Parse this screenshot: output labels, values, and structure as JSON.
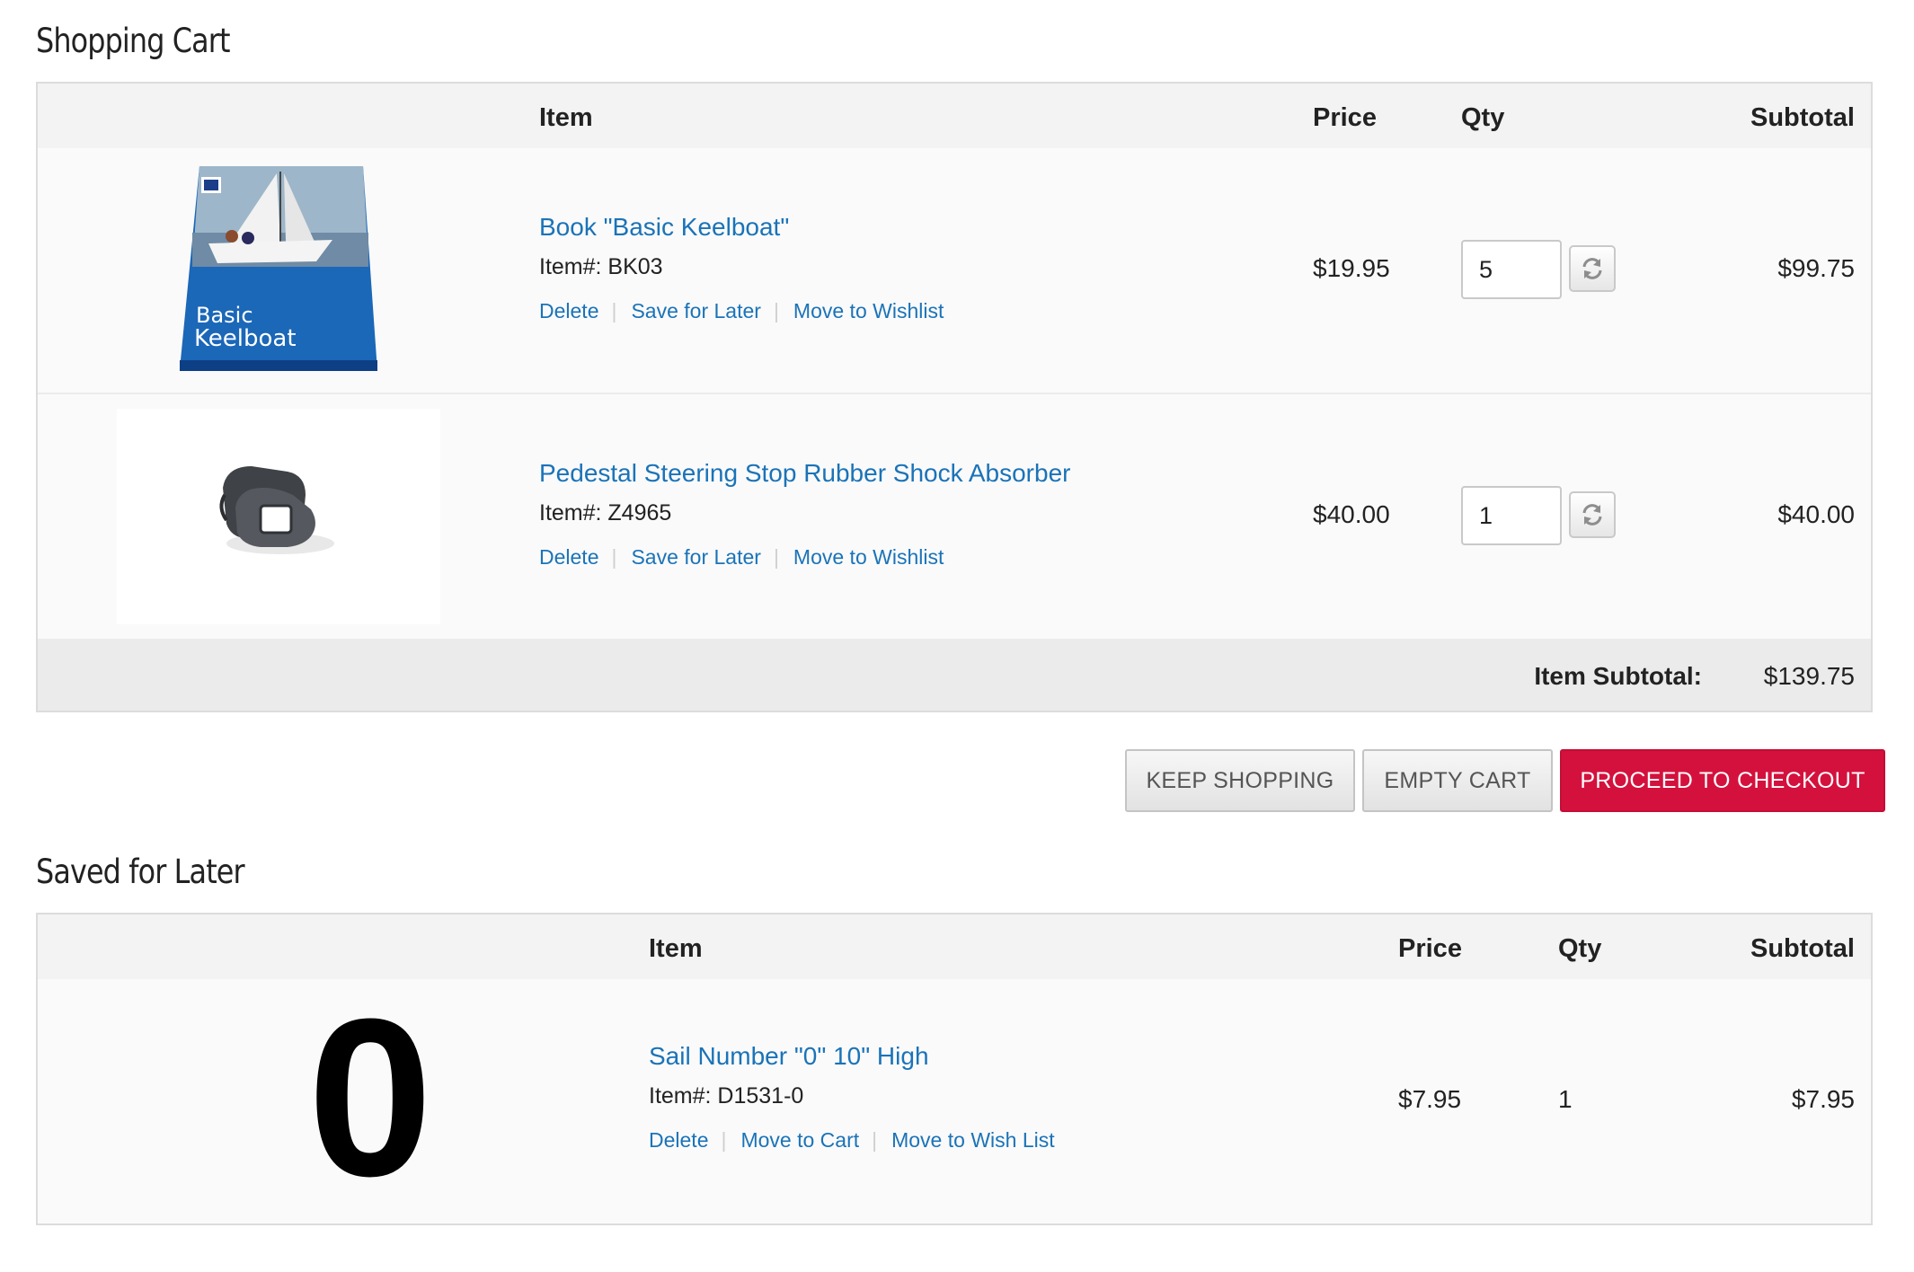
{
  "cart": {
    "title": "Shopping Cart",
    "headers": {
      "item": "Item",
      "price": "Price",
      "qty": "Qty",
      "subtotal": "Subtotal"
    },
    "items": [
      {
        "name": "Book \"Basic Keelboat\"",
        "code": "Item#: BK03",
        "price": "$19.95",
        "qty": "5",
        "subtotal": "$99.75",
        "cover_title_1": "Basic",
        "cover_title_2": "Keelboat",
        "actions": {
          "delete": "Delete",
          "save": "Save for Later",
          "wishlist": "Move to Wishlist"
        }
      },
      {
        "name": "Pedestal Steering Stop Rubber Shock Absorber",
        "code": "Item#: Z4965",
        "price": "$40.00",
        "qty": "1",
        "subtotal": "$40.00",
        "actions": {
          "delete": "Delete",
          "save": "Save for Later",
          "wishlist": "Move to Wishlist"
        }
      }
    ],
    "item_subtotal_label": "Item Subtotal:",
    "item_subtotal_value": "$139.75"
  },
  "buttons": {
    "keep_shopping": "KEEP SHOPPING",
    "empty_cart": "EMPTY CART",
    "checkout": "PROCEED TO CHECKOUT"
  },
  "saved": {
    "title": "Saved for Later",
    "headers": {
      "item": "Item",
      "price": "Price",
      "qty": "Qty",
      "subtotal": "Subtotal"
    },
    "items": [
      {
        "thumb_glyph": "0",
        "name": "Sail Number \"0\" 10\" High",
        "code": "Item#: D1531-0",
        "price": "$7.95",
        "qty": "1",
        "subtotal": "$7.95",
        "actions": {
          "delete": "Delete",
          "cart": "Move to Cart",
          "wishlist": "Move to Wish List"
        }
      }
    ]
  },
  "colors": {
    "link": "#1a73b8",
    "checkout": "#d4113d",
    "header_bg": "#f3f3f3",
    "subtotal_bg": "#ebebeb"
  },
  "icons": {
    "refresh": "refresh-icon"
  }
}
